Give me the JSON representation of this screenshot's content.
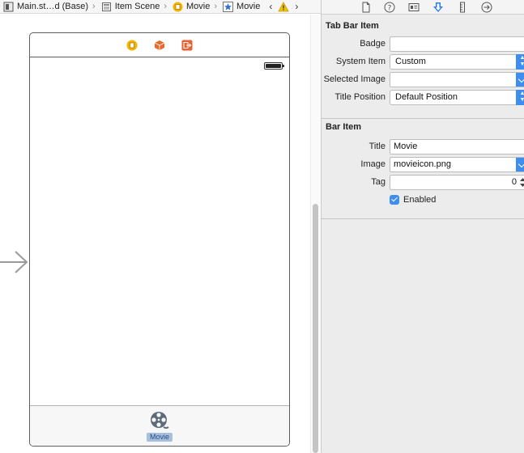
{
  "jumpbar": {
    "crumbs": [
      {
        "label": "Main.st…d (Base)",
        "icon": "storyboard-icon"
      },
      {
        "label": "Item Scene",
        "icon": "scene-icon"
      },
      {
        "label": "Movie",
        "icon": "view-controller-icon"
      },
      {
        "label": "Movie",
        "icon": "tab-bar-item-star-icon"
      }
    ],
    "back_icon": "chevron-left-icon",
    "warning_icon": "warning-icon"
  },
  "canvas": {
    "dock_icons": [
      "view-controller-icon",
      "first-responder-icon",
      "exit-icon"
    ],
    "tab_item": {
      "label": "Movie",
      "icon": "film-reel-icon"
    }
  },
  "inspector": {
    "tabs": [
      "file-icon",
      "help-icon",
      "identity-icon",
      "attributes-icon",
      "size-icon",
      "connections-icon"
    ],
    "active_tab": "attributes-icon",
    "tab_bar_item": {
      "title": "Tab Bar Item",
      "badge_label": "Badge",
      "badge_value": "",
      "system_item_label": "System Item",
      "system_item_value": "Custom",
      "selected_image_label": "Selected Image",
      "selected_image_value": "",
      "title_position_label": "Title Position",
      "title_position_value": "Default Position"
    },
    "bar_item": {
      "title": "Bar Item",
      "title_label": "Title",
      "title_value": "Movie",
      "image_label": "Image",
      "image_value": "movieicon.png",
      "tag_label": "Tag",
      "tag_value": "0",
      "enabled_label": "Enabled",
      "enabled_checked": true
    }
  },
  "colors": {
    "accent": "#3d8ef0",
    "tab_label_bg": "#a9bfdf",
    "inspector_bg": "#ececec"
  }
}
